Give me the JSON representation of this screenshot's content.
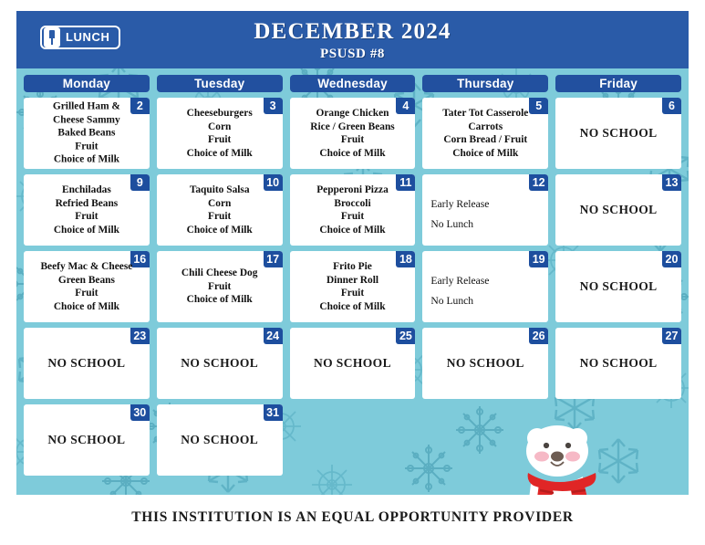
{
  "header": {
    "badge_label": "LUNCH",
    "badge_icon": "utensil-icon",
    "month_title": "DECEMBER 2024",
    "district_title": "PSUSD #8",
    "bar_color": "#2A5BA8"
  },
  "calendar": {
    "background_color": "#7ECBDA",
    "day_header_color": "#22509F",
    "day_number_color": "#1D4E9E",
    "day_headers": [
      "Monday",
      "Tuesday",
      "Wednesday",
      "Thursday",
      "Friday"
    ],
    "weeks": [
      [
        {
          "day": "2",
          "type": "menu",
          "lines": [
            "Grilled Ham &",
            "Cheese Sammy",
            "Baked Beans",
            "Fruit",
            "Choice of Milk"
          ]
        },
        {
          "day": "3",
          "type": "menu",
          "lines": [
            "Cheeseburgers",
            "Corn",
            "Fruit",
            "Choice of Milk"
          ]
        },
        {
          "day": "4",
          "type": "menu",
          "lines": [
            "Orange Chicken",
            "Rice / Green Beans",
            "Fruit",
            "Choice of Milk"
          ]
        },
        {
          "day": "5",
          "type": "menu",
          "lines": [
            "Tater Tot Casserole",
            "Carrots",
            "Corn Bread / Fruit",
            "Choice of Milk"
          ]
        },
        {
          "day": "6",
          "type": "noschool",
          "text": "NO SCHOOL"
        }
      ],
      [
        {
          "day": "9",
          "type": "menu",
          "lines": [
            "Enchiladas",
            "Refried Beans",
            "Fruit",
            "Choice of Milk"
          ]
        },
        {
          "day": "10",
          "type": "menu",
          "lines": [
            "Taquito Salsa",
            "Corn",
            "Fruit",
            "Choice of Milk"
          ]
        },
        {
          "day": "11",
          "type": "menu",
          "lines": [
            "Pepperoni Pizza",
            "Broccoli",
            "Fruit",
            "Choice of Milk"
          ]
        },
        {
          "day": "12",
          "type": "notes",
          "lines": [
            "Early Release",
            "No Lunch"
          ]
        },
        {
          "day": "13",
          "type": "noschool",
          "text": "NO SCHOOL"
        }
      ],
      [
        {
          "day": "16",
          "type": "menu",
          "lines": [
            "Beefy Mac & Cheese",
            "Green Beans",
            "Fruit",
            "Choice of Milk"
          ]
        },
        {
          "day": "17",
          "type": "menu",
          "lines": [
            "Chili Cheese Dog",
            "Fruit",
            "Choice of Milk"
          ]
        },
        {
          "day": "18",
          "type": "menu",
          "lines": [
            "Frito Pie",
            "Dinner Roll",
            "Fruit",
            "Choice of Milk"
          ]
        },
        {
          "day": "19",
          "type": "notes",
          "lines": [
            "Early Release",
            "No Lunch"
          ]
        },
        {
          "day": "20",
          "type": "noschool",
          "text": "NO SCHOOL"
        }
      ],
      [
        {
          "day": "23",
          "type": "noschool",
          "text": "NO SCHOOL"
        },
        {
          "day": "24",
          "type": "noschool",
          "text": "NO SCHOOL"
        },
        {
          "day": "25",
          "type": "noschool",
          "text": "NO SCHOOL"
        },
        {
          "day": "26",
          "type": "noschool",
          "text": "NO SCHOOL"
        },
        {
          "day": "27",
          "type": "noschool",
          "text": "NO SCHOOL"
        }
      ],
      [
        {
          "day": "30",
          "type": "noschool",
          "text": "NO SCHOOL"
        },
        {
          "day": "31",
          "type": "noschool",
          "text": "NO SCHOOL"
        },
        {
          "day": "",
          "type": "empty"
        },
        {
          "day": "",
          "type": "empty"
        },
        {
          "day": "",
          "type": "empty"
        }
      ]
    ],
    "decoration": {
      "illustration": "polar-bear-with-red-scarf",
      "bear_body_color": "#FFFFFF",
      "scarf_color": "#E02626",
      "cheek_color": "#F7B9C4",
      "snowflake_color": "#4FA6BC"
    }
  },
  "footer": {
    "text": "THIS INSTITUTION IS AN EQUAL OPPORTUNITY PROVIDER"
  }
}
